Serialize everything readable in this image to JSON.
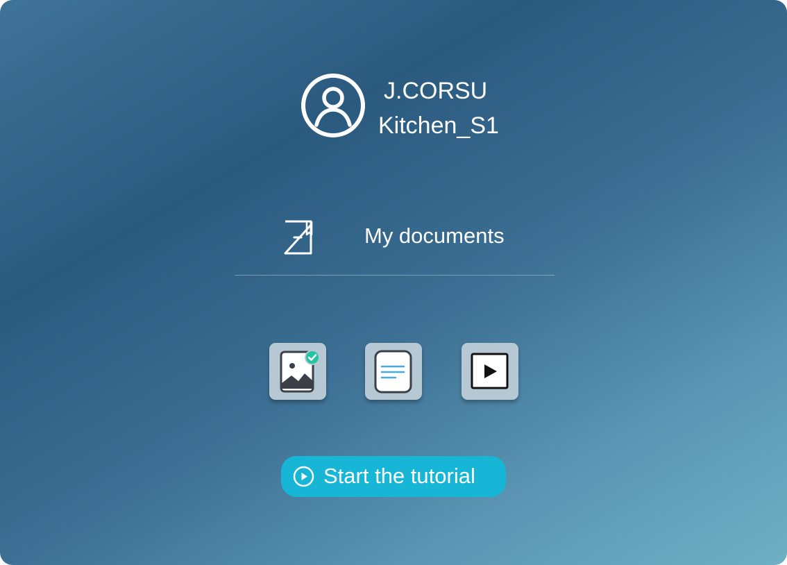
{
  "profile": {
    "user_name": "J.CORSU",
    "station": "Kitchen_S1",
    "icon": "user-circle-icon"
  },
  "documents": {
    "label": "My documents",
    "icon": "document-icon"
  },
  "tiles": [
    {
      "name": "images",
      "icon": "image-checked-icon"
    },
    {
      "name": "notes",
      "icon": "text-document-icon"
    },
    {
      "name": "video",
      "icon": "play-video-icon"
    }
  ],
  "tutorial": {
    "label": "Start the tutorial",
    "icon": "play-circle-icon"
  },
  "colors": {
    "accent": "#17b5d6",
    "tile_bg": "#b6c8d4",
    "check_badge": "#22c4a1",
    "notes_lines": "#4aa7e6"
  }
}
